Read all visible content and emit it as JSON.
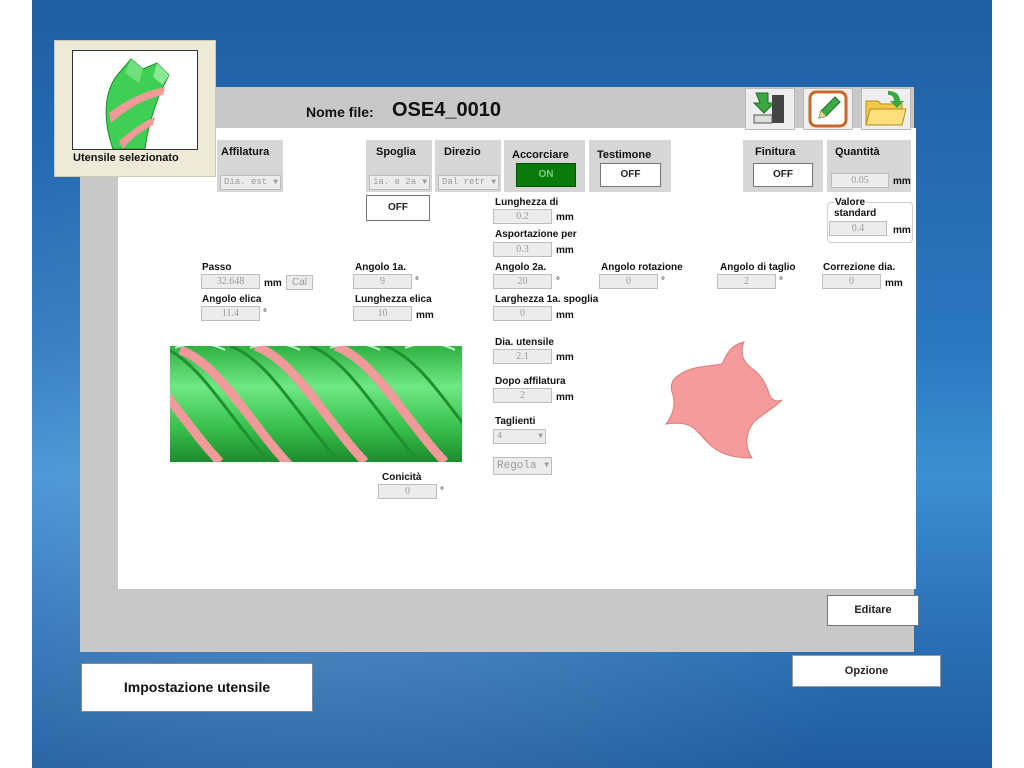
{
  "header": {
    "file_label": "Nome file:",
    "file_name": "OSE4_0010"
  },
  "selected_tool": {
    "caption": "Utensile selezionato"
  },
  "toolbar": {
    "icons": [
      "machine-export-icon",
      "edit-pencil-icon",
      "open-folder-icon"
    ]
  },
  "affilatura": {
    "label": "Affilatura",
    "value": "Dia. est"
  },
  "spoglia": {
    "label": "Spoglia",
    "value": "1a. e 2a",
    "toggle": "OFF"
  },
  "direzio": {
    "label": "Direzio",
    "value": "Dal retr"
  },
  "accorciare": {
    "label": "Accorciare",
    "state": "ON"
  },
  "testimone": {
    "label": "Testimone",
    "state": "OFF"
  },
  "finitura": {
    "label": "Finitura",
    "state": "OFF"
  },
  "quantita": {
    "label": "Quantità",
    "value": "0.05",
    "unit": "mm"
  },
  "valore_standard": {
    "label_line1": "Valore",
    "label_line2": "standard",
    "value": "0.4",
    "unit": "mm"
  },
  "lunghezza_di": {
    "label": "Lunghezza di",
    "value": "0.2",
    "unit": "mm"
  },
  "asportazione": {
    "label": "Asportazione per",
    "value": "0.3",
    "unit": "mm"
  },
  "passo": {
    "label": "Passo",
    "value": "32.648",
    "unit": "mm",
    "cal": "Cal"
  },
  "angolo_elica": {
    "label": "Angolo elica",
    "value": "11.4",
    "unit": "°"
  },
  "angolo_1a": {
    "label": "Angolo 1a.",
    "value": "9",
    "unit": "°"
  },
  "lunghezza_elica": {
    "label": "Lunghezza elica",
    "value": "10",
    "unit": "mm"
  },
  "angolo_2a": {
    "label": "Angolo 2a.",
    "value": "20",
    "unit": "°"
  },
  "larghezza_1a": {
    "label": "Larghezza 1a. spoglia",
    "value": "0",
    "unit": "mm"
  },
  "angolo_rotazione": {
    "label": "Angolo rotazione",
    "value": "0",
    "unit": "°"
  },
  "angolo_taglio": {
    "label": "Angolo di taglio",
    "value": "2",
    "unit": "°"
  },
  "correzione_dia": {
    "label": "Correzione dia.",
    "value": "0",
    "unit": "mm"
  },
  "dia_utensile": {
    "label": "Dia. utensile",
    "value": "2.1",
    "unit": "mm"
  },
  "dopo_affilatura": {
    "label": "Dopo affilatura",
    "value": "2",
    "unit": "mm"
  },
  "taglienti": {
    "label": "Taglienti",
    "value": "4"
  },
  "regola": {
    "value": "Regola"
  },
  "conicita": {
    "label": "Conicità",
    "value": "0",
    "unit": "°"
  },
  "buttons": {
    "editare": "Editare",
    "opzione": "Opzione",
    "impostazione": "Impostazione utensile"
  },
  "colors": {
    "accent_on": "#0a7a0a",
    "tool_green": "#3fcf55",
    "tool_pink": "#f29a9a",
    "profile_pink": "#f59b9c"
  }
}
